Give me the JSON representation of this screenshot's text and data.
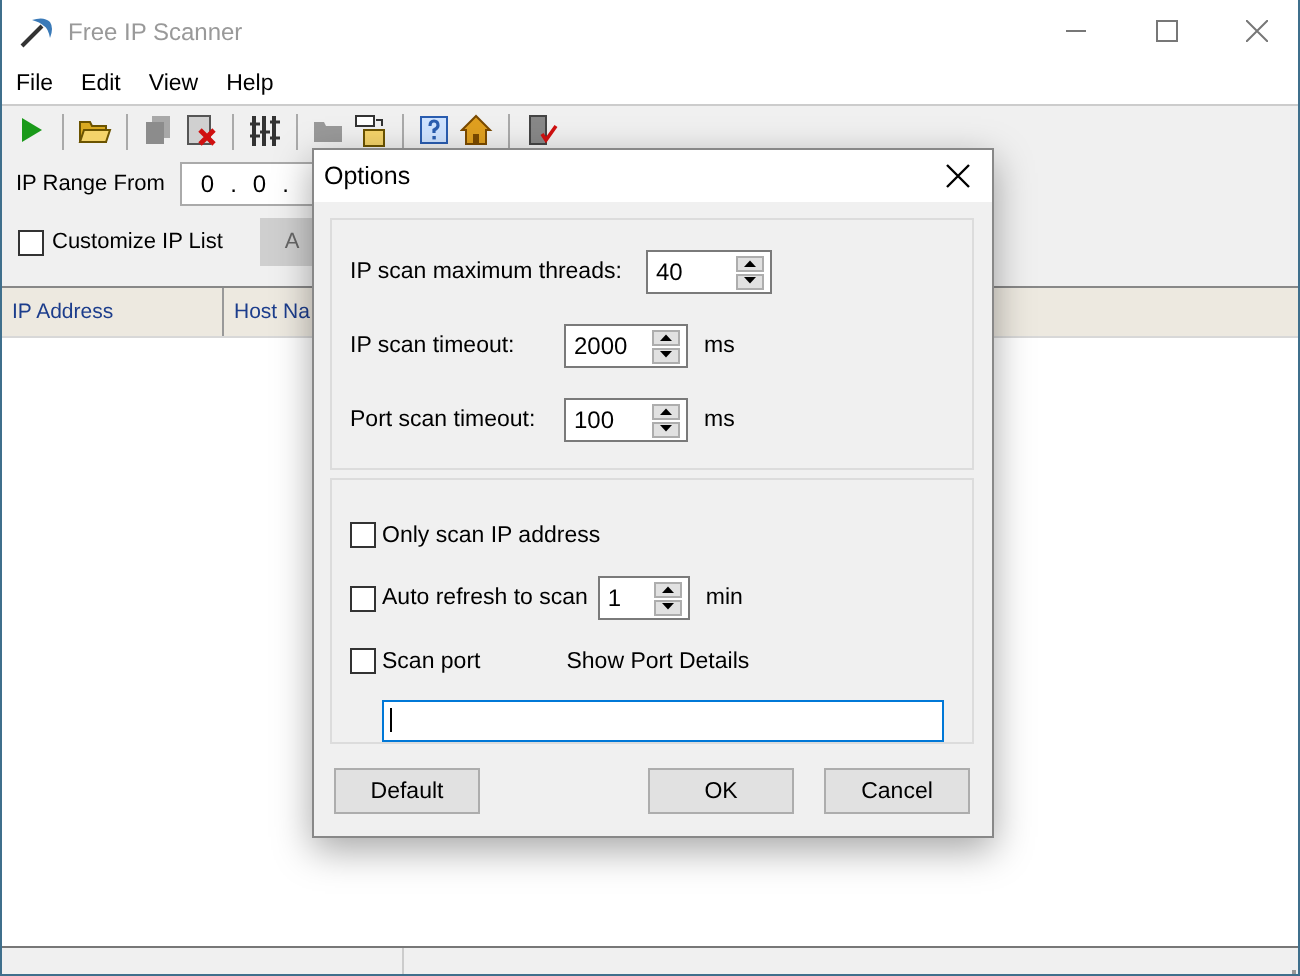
{
  "window": {
    "title": "Free IP Scanner"
  },
  "menu": [
    "File",
    "Edit",
    "View",
    "Help"
  ],
  "ip_range": {
    "label": "IP Range From",
    "segments": [
      "0",
      ".",
      "0",
      "."
    ]
  },
  "customize": {
    "label": "Customize IP List",
    "checked": false
  },
  "add_button": {
    "label": "A",
    "disabled": true
  },
  "table": {
    "columns": [
      "IP Address",
      "Host Na"
    ]
  },
  "dialog": {
    "title": "Options",
    "settings": [
      {
        "label": "IP scan maximum threads:",
        "value": "40"
      },
      {
        "label": "IP scan timeout:",
        "value": "2000",
        "unit": "ms"
      },
      {
        "label": "Port scan timeout:",
        "value": "100",
        "unit": "ms"
      }
    ],
    "options": [
      {
        "kind": "plain",
        "label": "Only scan IP address",
        "checked": false
      },
      {
        "kind": "spin",
        "label": "Auto refresh to scan",
        "checked": false,
        "value": "1",
        "unit": "min"
      },
      {
        "kind": "link",
        "label": "Scan port",
        "checked": false,
        "link": "Show Port Details"
      }
    ],
    "port_field": {
      "focused": true
    },
    "buttons": [
      "Default",
      "OK",
      "Cancel"
    ]
  }
}
